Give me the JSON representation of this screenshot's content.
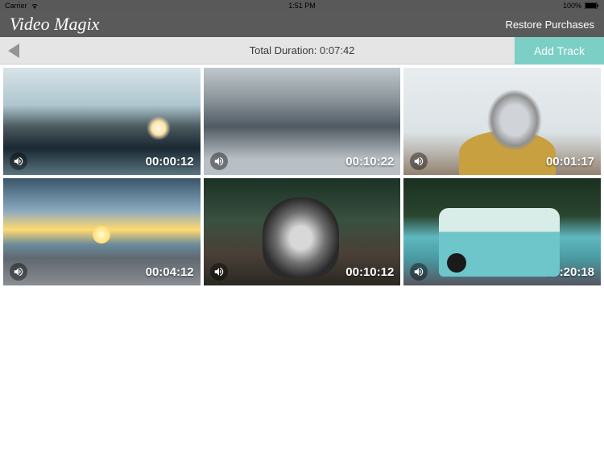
{
  "status": {
    "carrier": "Carrier",
    "time": "1:51 PM",
    "battery": "100%"
  },
  "header": {
    "appTitle": "Video Magix",
    "restoreLabel": "Restore Purchases"
  },
  "subHeader": {
    "durationLabel": "Total Duration: 0:07:42",
    "addTrackLabel": "Add Track"
  },
  "clips": [
    {
      "timestamp": "00:00:12"
    },
    {
      "timestamp": "00:10:22"
    },
    {
      "timestamp": "00:01:17"
    },
    {
      "timestamp": "00:04:12"
    },
    {
      "timestamp": "00:10:12"
    },
    {
      "timestamp": "00:20:18"
    }
  ]
}
